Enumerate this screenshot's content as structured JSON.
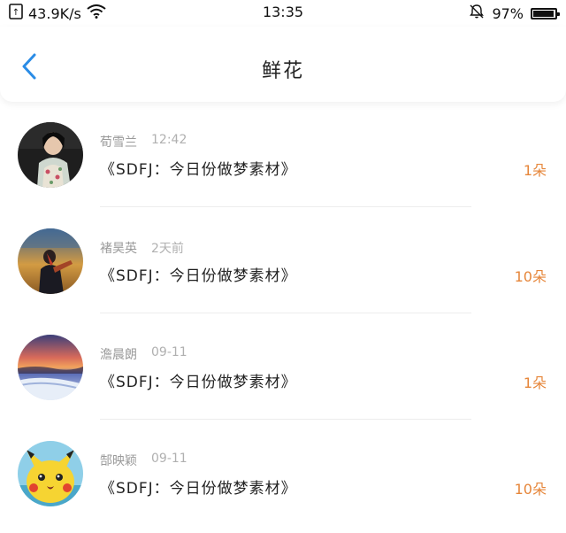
{
  "status_bar": {
    "network_speed": "43.9K/s",
    "time": "13:35",
    "battery_percent": "97%",
    "battery_level": 0.97
  },
  "header": {
    "title": "鲜花"
  },
  "colors": {
    "accent_blue": "#2a8ce6",
    "count_orange": "#e6863a",
    "meta_gray": "#9a9a9a"
  },
  "items": [
    {
      "name": "荀雪兰",
      "time": "12:42",
      "message": "《SDFJ：今日份做梦素材》",
      "count": "1朵",
      "avatar": "woman-portrait-avatar"
    },
    {
      "name": "褚昊英",
      "time": "2天前",
      "message": "《SDFJ：今日份做梦素材》",
      "count": "10朵",
      "avatar": "figure-sunset-avatar"
    },
    {
      "name": "澹晨朗",
      "time": "09-11",
      "message": "《SDFJ：今日份做梦素材》",
      "count": "1朵",
      "avatar": "landscape-sunset-avatar"
    },
    {
      "name": "郜映颖",
      "time": "09-11",
      "message": "《SDFJ：今日份做梦素材》",
      "count": "10朵",
      "avatar": "pikachu-avatar"
    }
  ]
}
